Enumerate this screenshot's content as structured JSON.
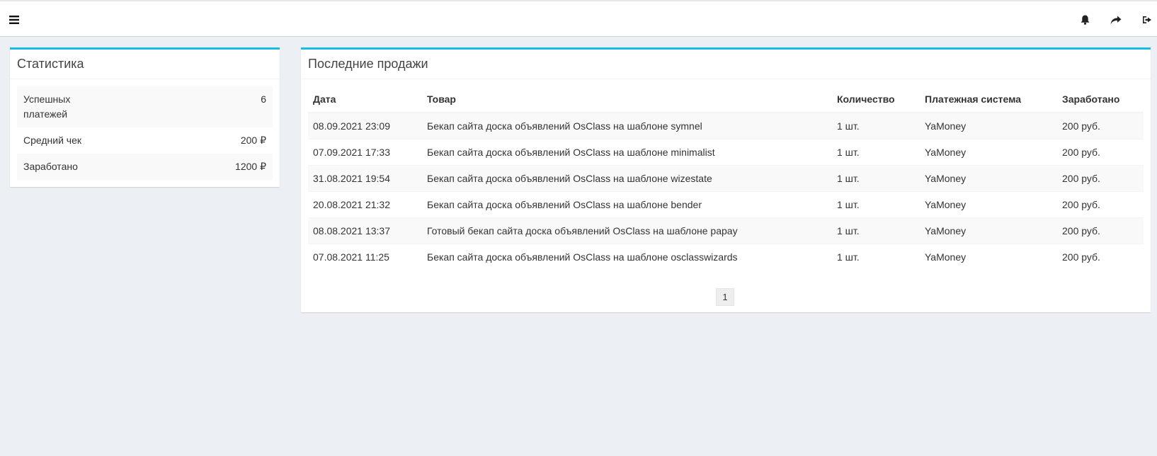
{
  "topbar": {
    "menu_icon": "hamburger-icon",
    "bell_icon": "bell-icon",
    "share_icon": "share-arrow-icon",
    "logout_icon": "sign-out-icon"
  },
  "stats": {
    "title": "Статистика",
    "rows": [
      {
        "label": "Успешных платежей",
        "value": "6"
      },
      {
        "label": "Средний чек",
        "value": "200 ₽"
      },
      {
        "label": "Заработано",
        "value": "1200 ₽"
      }
    ]
  },
  "sales": {
    "title": "Последние продажи",
    "columns": [
      "Дата",
      "Товар",
      "Количество",
      "Платежная система",
      "Заработано"
    ],
    "rows": [
      [
        "08.09.2021 23:09",
        "Бекап сайта доска объявлений OsClass на шаблоне symnel",
        "1 шт.",
        "YaMoney",
        "200 руб."
      ],
      [
        "07.09.2021 17:33",
        "Бекап сайта доска объявлений OsClass на шаблоне minimalist",
        "1 шт.",
        "YaMoney",
        "200 руб."
      ],
      [
        "31.08.2021 19:54",
        "Бекап сайта доска объявлений OsClass на шаблоне wizestate",
        "1 шт.",
        "YaMoney",
        "200 руб."
      ],
      [
        "20.08.2021 21:32",
        "Бекап сайта доска объявлений OsClass на шаблоне bender",
        "1 шт.",
        "YaMoney",
        "200 руб."
      ],
      [
        "08.08.2021 13:37",
        "Готовый бекап сайта доска объявлений OsClass на шаблоне papay",
        "1 шт.",
        "YaMoney",
        "200 руб."
      ],
      [
        "07.08.2021 11:25",
        "Бекап сайта доска объявлений OsClass на шаблоне osclasswizards",
        "1 шт.",
        "YaMoney",
        "200 руб."
      ]
    ],
    "pagination": {
      "current_page": "1"
    }
  },
  "colors": {
    "accent": "#1eb8e6",
    "background": "#ecf0f5"
  }
}
